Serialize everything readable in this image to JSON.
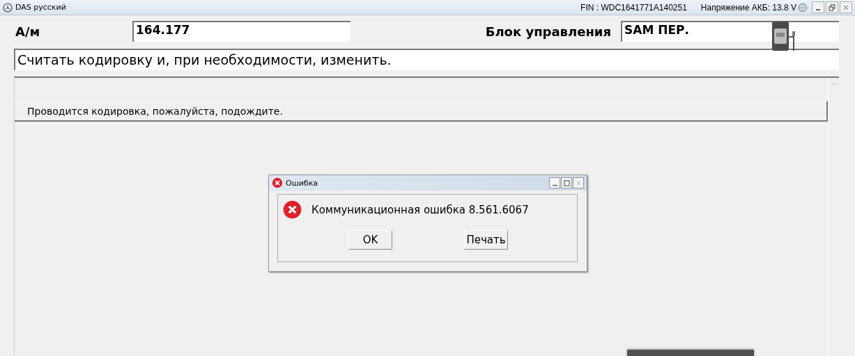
{
  "window": {
    "title": "DAS русский",
    "fin": "FIN : WDC1641771A140251",
    "voltage": "Напряжение АКБ: 13.8 V"
  },
  "header": {
    "vehicle_label": "А/м",
    "vehicle_value": "164.177",
    "unit_label": "Блок управления",
    "unit_value": "SAM ПЕР."
  },
  "instruction": "Считать кодировку и, при необходимости, изменить.",
  "status_message": "Проводится кодировка, пожалуйста, подождите.",
  "dialog": {
    "title": "Ошибка",
    "message": "Коммуникационная ошибка 8.561.6067",
    "buttons": [
      "OK",
      "Печать"
    ]
  }
}
